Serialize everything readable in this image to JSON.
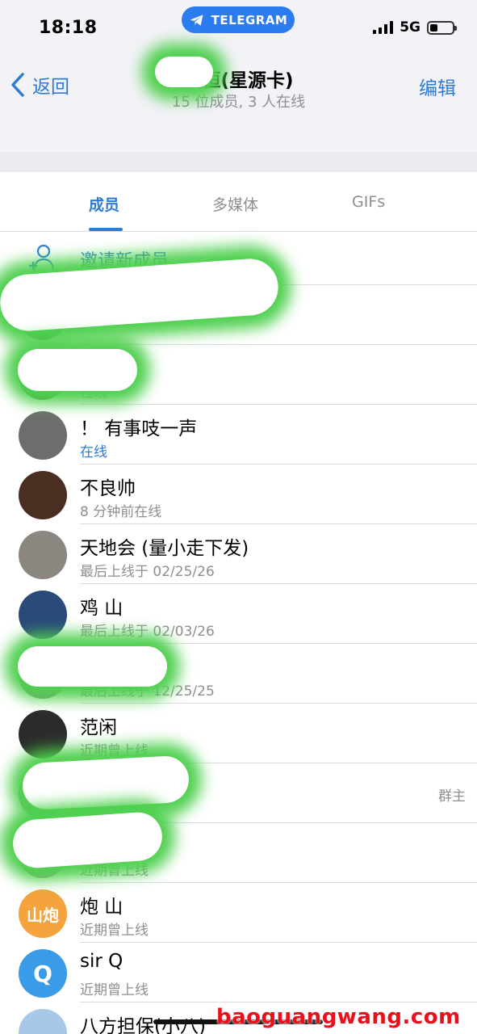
{
  "status_bar": {
    "time": "18:18",
    "pill_label": "TELEGRAM",
    "network": "5G"
  },
  "nav": {
    "back_label": "返回",
    "title": "汇恒(星源卡)",
    "subtitle": "15 位成员, 3 人在线",
    "edit_label": "编辑"
  },
  "tabs": [
    {
      "label": "成员",
      "active": true
    },
    {
      "label": "多媒体",
      "active": false
    },
    {
      "label": "GIFs",
      "active": false
    }
  ],
  "invite": {
    "label": "邀请新成员",
    "icon": "add-user-icon"
  },
  "members": [
    {
      "name": "",
      "status": "",
      "role": "",
      "avatar_color": "#4a8a4a",
      "avatar_text": ""
    },
    {
      "name": "",
      "status": "在线",
      "role": "",
      "avatar_color": "#5a8f5a",
      "avatar_text": ""
    },
    {
      "name": "！ 有事吱一声",
      "status": "在线",
      "online": true,
      "role": "",
      "avatar_color": "#6d6d6d",
      "avatar_text": ""
    },
    {
      "name": "不良帅",
      "status": "8 分钟前在线",
      "role": "",
      "avatar_color": "#4a2e22",
      "avatar_text": ""
    },
    {
      "name": "天地会 (量小走下发)",
      "status": "最后上线于 02/25/26",
      "role": "",
      "avatar_color": "#8b8680",
      "avatar_text": ""
    },
    {
      "name": "鸡 山",
      "status": "最后上线于 02/03/26",
      "role": "",
      "avatar_color": "#2a4a7a",
      "avatar_text": ""
    },
    {
      "name": "",
      "status": "最后上线于 12/25/25",
      "role": "",
      "avatar_color": "#7a9a7a",
      "avatar_text": ""
    },
    {
      "name": "范闲",
      "status": "近期曾上线",
      "role": "",
      "avatar_color": "#2b2b2b",
      "avatar_text": ""
    },
    {
      "name": "",
      "status": "",
      "role": "群主",
      "avatar_color": "#8aa88a",
      "avatar_text": ""
    },
    {
      "name": "",
      "status": "近期曾上线",
      "role": "",
      "avatar_color": "#9aa89a",
      "avatar_text": ""
    },
    {
      "name": "炮 山",
      "status": "近期曾上线",
      "role": "",
      "avatar_color": "#f5a33c",
      "avatar_text": "山炮"
    },
    {
      "name": "sir Q",
      "status": "近期曾上线",
      "role": "",
      "avatar_color": "#3a9be8",
      "avatar_text": "Q"
    },
    {
      "name": "八方担保(小八)",
      "status": "",
      "role": "",
      "avatar_color": "#a8c8e8",
      "avatar_text": ""
    }
  ],
  "watermark": "baoguangwang.com",
  "colors": {
    "accent": "#2e7bd6",
    "redaction_glow": "#4fd04f",
    "watermark": "#e8101a"
  }
}
